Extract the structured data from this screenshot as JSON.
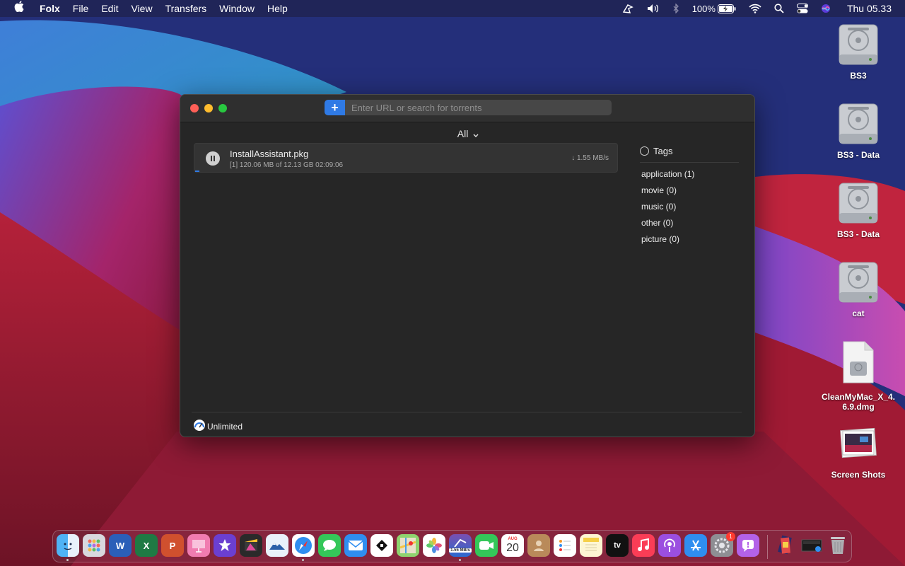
{
  "menubar": {
    "app_name": "Folx",
    "items": [
      "File",
      "Edit",
      "View",
      "Transfers",
      "Window",
      "Help"
    ],
    "battery": "100%",
    "clock": "Thu 05.33"
  },
  "desktop": {
    "icons": [
      {
        "label": "BS3",
        "icon": "hard-drive-icon"
      },
      {
        "label": "BS3 - Data",
        "icon": "hard-drive-icon"
      },
      {
        "label": "BS3 - Data",
        "icon": "hard-drive-icon"
      },
      {
        "label": "cat",
        "icon": "hard-drive-icon"
      },
      {
        "label": "CleanMyMac_X_4.",
        "label2": "6.9.dmg",
        "icon": "dmg-file-icon"
      },
      {
        "label": "Screen Shots",
        "icon": "folder-icon"
      }
    ]
  },
  "window": {
    "search_placeholder": "Enter URL or search for torrents",
    "add_label": "+",
    "filter_label": "All",
    "download": {
      "name": "InstallAssistant.pkg",
      "details": "[1] 120.06 MB of 12.13 GB  02:09:06",
      "speed": "↓ 1.55 MB/s",
      "progress_percent": 1
    },
    "tags": {
      "title": "Tags",
      "items": [
        "application (1)",
        "movie (0)",
        "music (0)",
        "other (0)",
        "picture (0)"
      ]
    },
    "speed_limit": "Unlimited"
  },
  "dock": {
    "folx_badge": "1.55 MB/s",
    "calendar_month": "AUG",
    "calendar_day": "20",
    "tv_label": "tv",
    "settings_badge": "1"
  },
  "colors": {
    "accent": "#2f7ae5",
    "window_bg": "#262626"
  }
}
